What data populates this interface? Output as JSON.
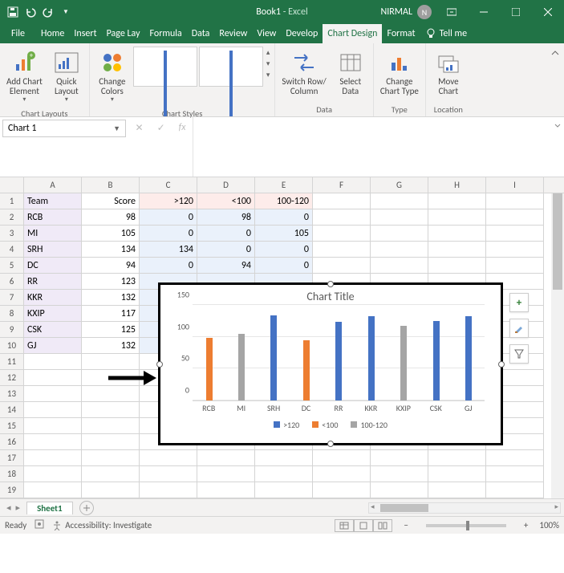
{
  "titlebar": {
    "title_book": "Book1",
    "title_sep": " - ",
    "title_app": "Excel",
    "user": "NIRMAL",
    "user_initial": "N"
  },
  "tabs": {
    "file": "File",
    "home": "Home",
    "insert": "Insert",
    "pagelayout": "Page Lay",
    "formulas": "Formula",
    "data": "Data",
    "review": "Review",
    "view": "View",
    "developer": "Develop",
    "chartdesign": "Chart Design",
    "format": "Format",
    "tellme": "Tell me"
  },
  "ribbon": {
    "group_chartlayouts": "Chart Layouts",
    "add_chart_element_l1": "Add Chart",
    "add_chart_element_l2": "Element",
    "quick_layout_l1": "Quick",
    "quick_layout_l2": "Layout",
    "group_chartstyles": "Chart Styles",
    "change_colors_l1": "Change",
    "change_colors_l2": "Colors",
    "group_data": "Data",
    "switch_rowcol_l1": "Switch Row/",
    "switch_rowcol_l2": "Column",
    "select_data_l1": "Select",
    "select_data_l2": "Data",
    "group_type": "Type",
    "change_chart_type_l1": "Change",
    "change_chart_type_l2": "Chart Type",
    "group_location": "Location",
    "move_chart_l1": "Move",
    "move_chart_l2": "Chart"
  },
  "formula": {
    "namebox": "Chart 1",
    "fx_label": "fx"
  },
  "columns": [
    "A",
    "B",
    "C",
    "D",
    "E",
    "F",
    "G",
    "H",
    "I"
  ],
  "grid": {
    "header": {
      "A": "Team",
      "B": "Score",
      "C": ">120",
      "D": "<100",
      "E": "100-120"
    },
    "rows": [
      {
        "A": "RCB",
        "B": "98",
        "C": "0",
        "D": "98",
        "E": "0"
      },
      {
        "A": "MI",
        "B": "105",
        "C": "0",
        "D": "0",
        "E": "105"
      },
      {
        "A": "SRH",
        "B": "134",
        "C": "134",
        "D": "0",
        "E": "0"
      },
      {
        "A": "DC",
        "B": "94",
        "C": "0",
        "D": "94",
        "E": "0"
      },
      {
        "A": "RR",
        "B": "123"
      },
      {
        "A": "KKR",
        "B": "132"
      },
      {
        "A": "KXIP",
        "B": "117"
      },
      {
        "A": "CSK",
        "B": "125"
      },
      {
        "A": "GJ",
        "B": "132"
      }
    ],
    "blank_rows": 9
  },
  "chart": {
    "title": "Chart Title",
    "side_plus": "+",
    "legend1": ">120",
    "legend2": "<100",
    "legend3": "100-120",
    "yticks": [
      "0",
      "50",
      "100",
      "150"
    ]
  },
  "sheet": {
    "tab": "Sheet1",
    "add": "+"
  },
  "status": {
    "ready": "Ready",
    "accessibility": "Accessibility: Investigate",
    "zoom": "100%"
  },
  "chart_data": {
    "type": "bar",
    "title": "Chart Title",
    "categories": [
      "RCB",
      "MI",
      "SRH",
      "DC",
      "RR",
      "KKR",
      "KXIP",
      "CSK",
      "GJ"
    ],
    "series": [
      {
        "name": ">120",
        "color": "#4472c4",
        "values": [
          0,
          0,
          134,
          0,
          123,
          132,
          0,
          125,
          132
        ]
      },
      {
        "name": "<100",
        "color": "#ed7d31",
        "values": [
          98,
          0,
          0,
          94,
          0,
          0,
          0,
          0,
          0
        ]
      },
      {
        "name": "100-120",
        "color": "#a5a5a5",
        "values": [
          0,
          105,
          0,
          0,
          0,
          0,
          117,
          0,
          0
        ]
      }
    ],
    "ylabel": "",
    "xlabel": "",
    "ylim": [
      0,
      150
    ],
    "yticks": [
      0,
      50,
      100,
      150
    ]
  }
}
